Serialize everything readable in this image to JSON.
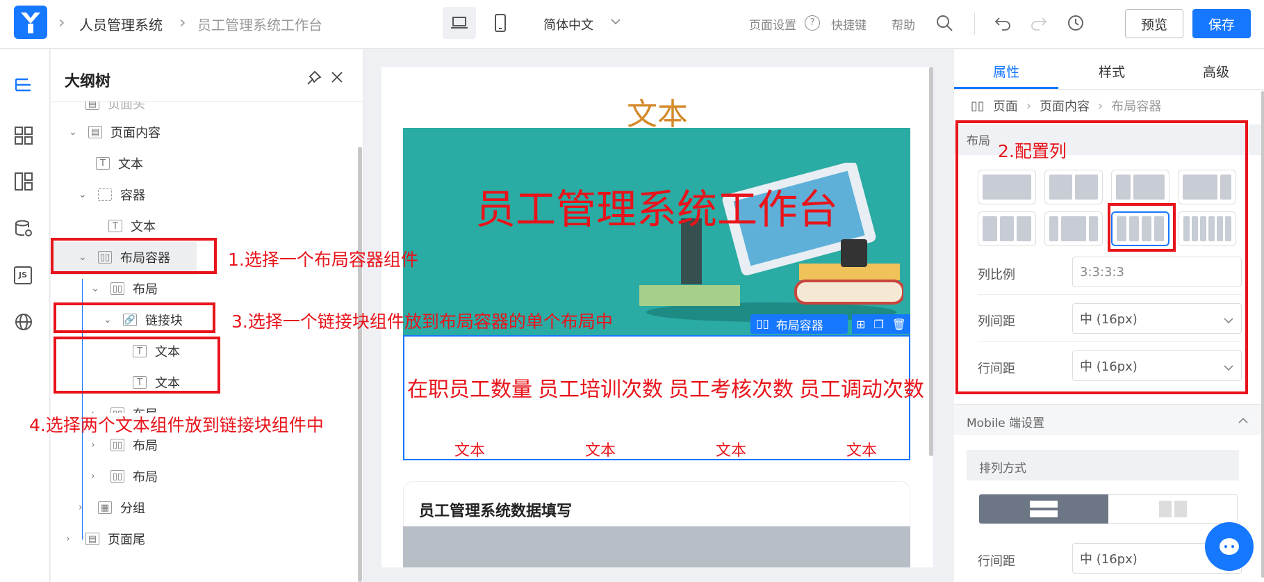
{
  "header": {
    "app_name": "人员管理系统",
    "page_name": "员工管理系统工作台",
    "language": "简体中文",
    "page_settings": "页面设置",
    "shortcuts": "快捷键",
    "help": "帮助",
    "preview": "预览",
    "save": "保存"
  },
  "iconbar": {
    "items": [
      "outline-tree-icon",
      "components-icon",
      "layout-icon",
      "datasource-icon",
      "js-icon",
      "globe-icon"
    ],
    "js_text": "JS"
  },
  "outline": {
    "title": "大纲树",
    "items": [
      {
        "label": "页面头"
      },
      {
        "label": "页面内容"
      },
      {
        "label": "文本"
      },
      {
        "label": "容器"
      },
      {
        "label": "文本"
      },
      {
        "label": "布局容器"
      },
      {
        "label": "布局"
      },
      {
        "label": "链接块"
      },
      {
        "label": "文本"
      },
      {
        "label": "文本"
      },
      {
        "label": "布局"
      },
      {
        "label": "布局"
      },
      {
        "label": "布局"
      },
      {
        "label": "分组"
      },
      {
        "label": "页面尾"
      }
    ]
  },
  "annotations": {
    "step1": "1.选择一个布局容器组件",
    "step2": "2.配置列",
    "step3": "3.选择一个链接块组件放到布局容器的单个布局中",
    "step4": "4.选择两个文本组件放到链接块组件中"
  },
  "canvas": {
    "top_text": "文本",
    "banner_title": "员工管理系统工作台",
    "toolbar_label": "布局容器",
    "stats": [
      {
        "title": "在职员工数量",
        "sub": "文本"
      },
      {
        "title": "员工培训次数",
        "sub": "文本"
      },
      {
        "title": "员工考核次数",
        "sub": "文本"
      },
      {
        "title": "员工调动次数",
        "sub": "文本"
      }
    ],
    "section_title": "员工管理系统数据填写"
  },
  "rightpanel": {
    "tabs": [
      "属性",
      "样式",
      "高级"
    ],
    "breadcrumb": [
      "页面",
      "页面内容",
      "布局容器"
    ],
    "layout_group": "布局",
    "column_ratio_label": "列比例",
    "column_ratio_value": "3:3:3:3",
    "column_gap_label": "列间距",
    "column_gap_value": "中 (16px)",
    "row_gap_label": "行间距",
    "row_gap_value": "中 (16px)",
    "mobile_title": "Mobile 端设置",
    "arrange_label": "排列方式",
    "mobile_row_gap_label": "行间距",
    "mobile_row_gap_value": "中 (16px)"
  },
  "colors": {
    "accent": "#1677ff",
    "annotation_red": "#e8141b",
    "banner_teal": "#2aaba3",
    "top_text_orange": "#d48a2a"
  }
}
